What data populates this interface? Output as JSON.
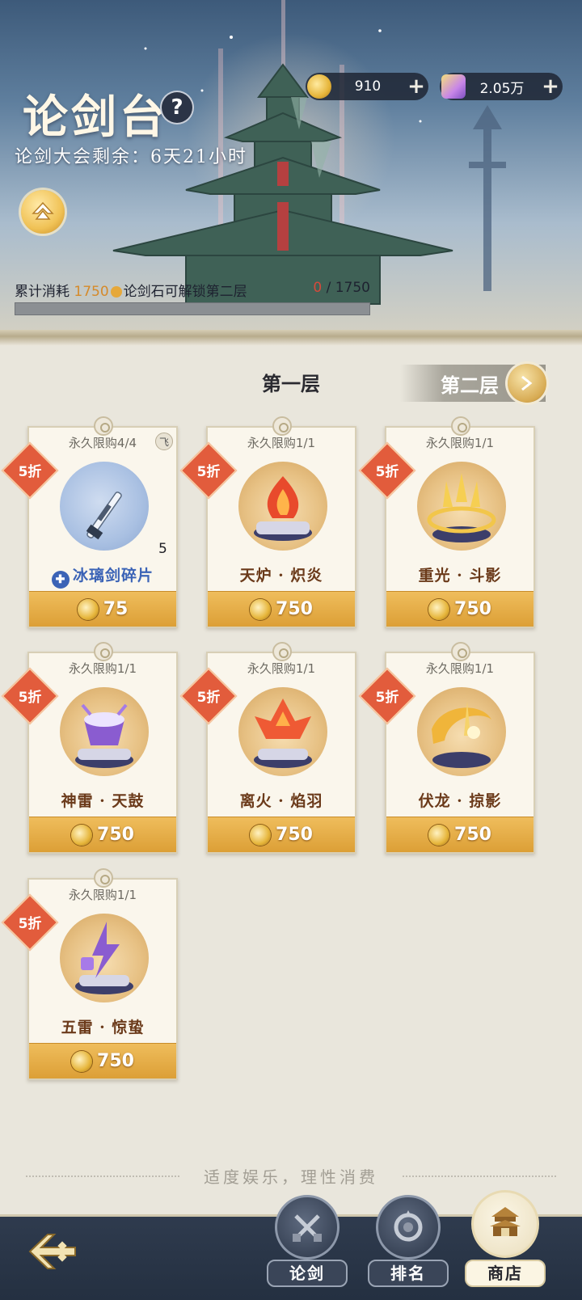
{
  "header": {
    "title": "论剑台",
    "help_label": "?",
    "countdown": "论剑大会剩余：6天21小时",
    "rank_icon": "rank-chevron-icon"
  },
  "currencies": [
    {
      "name": "coin",
      "icon": "sword-coin-icon",
      "value": "910",
      "plus": "+"
    },
    {
      "name": "gem",
      "icon": "jade-ticket-icon",
      "value": "2.05万",
      "plus": "+"
    }
  ],
  "unlock": {
    "prefix": "累计消耗 ",
    "amount": "1750",
    "suffix": "论剑石可解锁第二层",
    "current": "0",
    "separator": " / ",
    "target": "1750",
    "progress": 0
  },
  "tabs": {
    "active": "第一层",
    "inactive": "第二层"
  },
  "items": [
    {
      "limit": "永久限购4/4",
      "discount": "5折",
      "name": "冰璃剑碎片",
      "qty": "5",
      "price": "75",
      "fly": "飞",
      "art": "sword"
    },
    {
      "limit": "永久限购1/1",
      "discount": "5折",
      "name": "天炉 · 炽炎",
      "price": "750",
      "art": "flame"
    },
    {
      "limit": "永久限购1/1",
      "discount": "5折",
      "name": "重光 · 斗影",
      "price": "750",
      "art": "trident"
    },
    {
      "limit": "永久限购1/1",
      "discount": "5折",
      "name": "神雷 · 天鼓",
      "price": "750",
      "art": "drum"
    },
    {
      "limit": "永久限购1/1",
      "discount": "5折",
      "name": "离火 · 焰羽",
      "price": "750",
      "art": "feather"
    },
    {
      "limit": "永久限购1/1",
      "discount": "5折",
      "name": "伏龙 · 掠影",
      "price": "750",
      "art": "dragon"
    },
    {
      "limit": "永久限购1/1",
      "discount": "5折",
      "name": "五雷 · 惊蛰",
      "price": "750",
      "art": "thunder"
    }
  ],
  "footer": {
    "note": "适度娱乐，理性消费"
  },
  "nav": {
    "back_icon": "back-arrow-icon",
    "items": [
      {
        "label": "论剑",
        "icon": "crossed-swords-icon"
      },
      {
        "label": "排名",
        "icon": "ranking-emblem-icon"
      },
      {
        "label": "商店",
        "icon": "shop-pavilion-icon"
      }
    ]
  },
  "colors": {
    "accent_gold": "#dc9f36",
    "discount_red": "#e25c3c",
    "name_brown": "#6b3a1a",
    "name_blue": "#3b63b6",
    "nav_bg": "#2f3b4e"
  }
}
